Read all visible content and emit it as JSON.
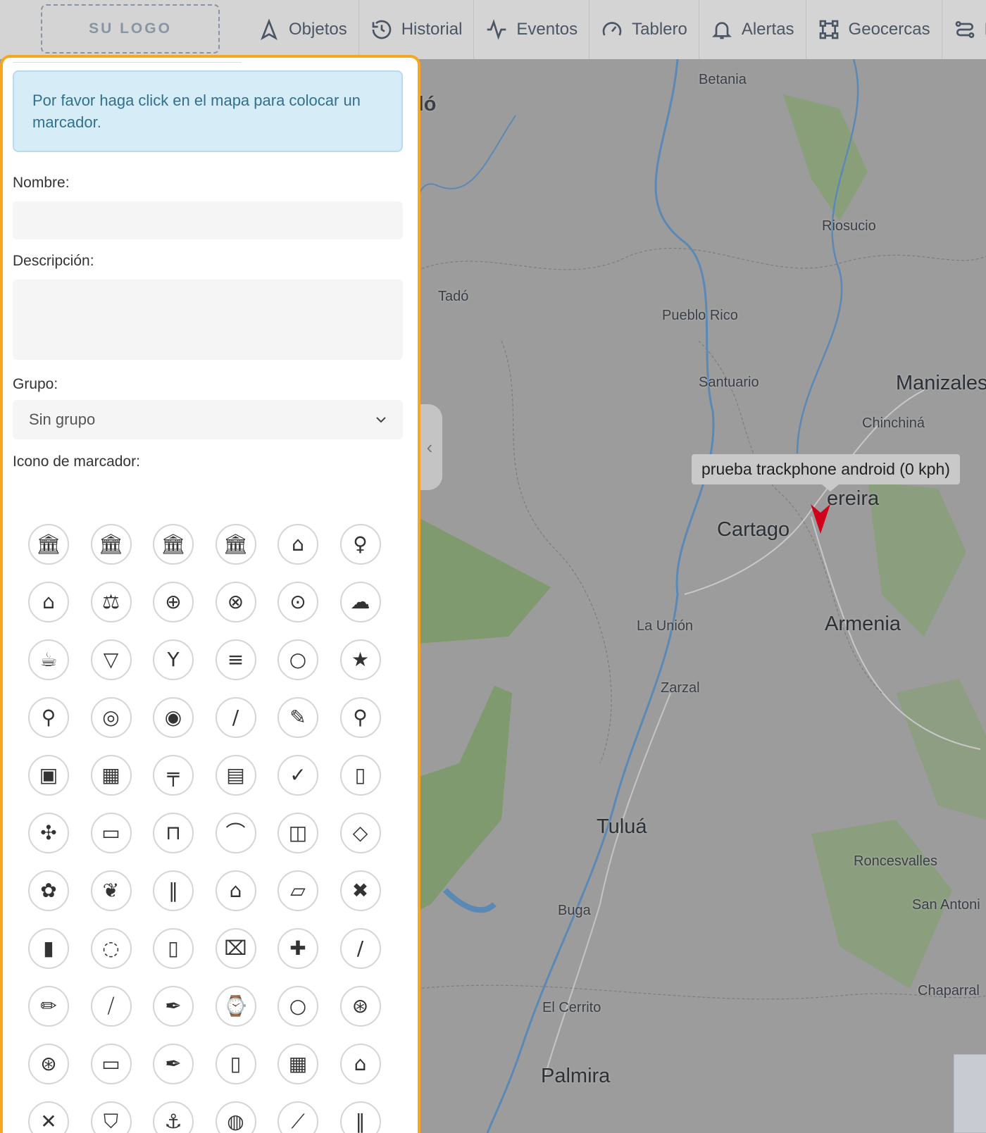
{
  "header": {
    "logo_text": "SU LOGO",
    "nav": [
      {
        "label": "Objetos",
        "icon": "navigation-icon"
      },
      {
        "label": "Historial",
        "icon": "history-icon"
      },
      {
        "label": "Eventos",
        "icon": "activity-icon"
      },
      {
        "label": "Tablero",
        "icon": "gauge-icon"
      },
      {
        "label": "Alertas",
        "icon": "bell-icon"
      },
      {
        "label": "Geocercas",
        "icon": "geofence-icon"
      },
      {
        "label": "R",
        "icon": "route-icon"
      }
    ]
  },
  "panel": {
    "info_message": "Por favor haga click en el mapa para colocar un marcador.",
    "name_label": "Nombre:",
    "name_value": "",
    "description_label": "Descripción:",
    "description_value": "",
    "group_label": "Grupo:",
    "group_selected": "Sin grupo",
    "icon_label": "Icono de marcador:",
    "icons": [
      "bank-icon",
      "bank-star-icon",
      "bank-check-icon",
      "bank-off-icon",
      "iron-icon",
      "balloon-icon",
      "store-icon",
      "scale-icon",
      "restaurant-icon",
      "plate-cutlery-icon",
      "dining-icon",
      "chef-hat-icon",
      "coffee-icon",
      "ice-cream-icon",
      "wine-glass-icon",
      "burger-icon",
      "lollipop-icon",
      "store-star-icon",
      "broom-icon",
      "paper-roll-icon",
      "tape-icon",
      "screwdriver-icon",
      "brush-icon",
      "magnifier-icon",
      "safe-icon",
      "brick-wall-icon",
      "pipe-icon",
      "blocks-icon",
      "store-check-icon",
      "wardrobe-icon",
      "fan-icon",
      "armchair-icon",
      "bed-icon",
      "desk-lamp-icon",
      "cctv-icon",
      "trowel-icon",
      "flower-pot-icon",
      "plant-icon",
      "fence-icon",
      "shop-icon",
      "bandage-icon",
      "bandage-cross-icon",
      "baby-bottle-icon",
      "pacifier-icon",
      "pill-jar-icon",
      "spray-bottle-icon",
      "first-aid-icon",
      "toothbrush-icon",
      "pencil-icon",
      "razor-icon",
      "marker-icon",
      "watch-icon",
      "ring-icon",
      "wheel-icon",
      "tire-icon",
      "battery-icon",
      "pen-icon",
      "notebook-icon",
      "calendar-icon",
      "graduation-cap-icon",
      "tools-icon",
      "shield-icon",
      "anchor-icon",
      "apple-icon",
      "knife-icon",
      "pencils-icon"
    ]
  },
  "map": {
    "labels": [
      {
        "text": "Betania",
        "size": "small"
      },
      {
        "text": "dó",
        "size": "xl"
      },
      {
        "text": "Riosucio",
        "size": "small"
      },
      {
        "text": "Tadó",
        "size": "small"
      },
      {
        "text": "Pueblo Rico",
        "size": "small"
      },
      {
        "text": "Santuario",
        "size": "small"
      },
      {
        "text": "Manizales",
        "size": "big"
      },
      {
        "text": "Chinchiná",
        "size": "small"
      },
      {
        "text": "ereira",
        "size": "big"
      },
      {
        "text": "Cartago",
        "size": "big"
      },
      {
        "text": "Armenia",
        "size": "big"
      },
      {
        "text": "La Unión",
        "size": "small"
      },
      {
        "text": "Zarzal",
        "size": "small"
      },
      {
        "text": "Tuluá",
        "size": "big"
      },
      {
        "text": "Roncesvalles",
        "size": "small"
      },
      {
        "text": "San Antoni",
        "size": "small"
      },
      {
        "text": "Buga",
        "size": "small"
      },
      {
        "text": "Chaparral",
        "size": "small"
      },
      {
        "text": "El Cerrito",
        "size": "small"
      },
      {
        "text": "Palmira",
        "size": "big"
      }
    ],
    "tooltip": "prueba trackphone android (0 kph)",
    "colors": {
      "land": "#9c9c9c",
      "forest": "#7f9a6e",
      "water": "#5b89b5",
      "marker": "#d0021b"
    }
  }
}
